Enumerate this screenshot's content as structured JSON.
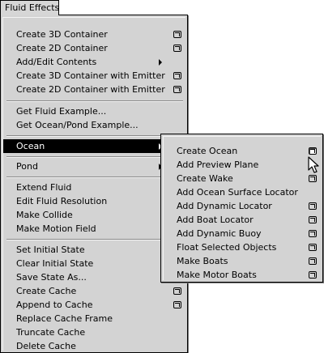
{
  "menubar": {
    "title": "Fluid Effects"
  },
  "menu": {
    "group1": [
      {
        "label": "Create 3D Container",
        "option_box": true
      },
      {
        "label": "Create 2D Container",
        "option_box": true
      },
      {
        "label": "Add/Edit Contents",
        "submenu": true
      },
      {
        "label": "Create 3D Container with Emitter",
        "option_box": true
      },
      {
        "label": "Create 2D Container with Emitter",
        "option_box": true
      }
    ],
    "group2": [
      {
        "label": "Get Fluid Example..."
      },
      {
        "label": "Get Ocean/Pond Example..."
      }
    ],
    "group3": [
      {
        "label": "Ocean",
        "submenu": true,
        "highlighted": true
      }
    ],
    "group4": [
      {
        "label": "Pond",
        "submenu": true
      }
    ],
    "group5": [
      {
        "label": "Extend Fluid"
      },
      {
        "label": "Edit Fluid Resolution"
      },
      {
        "label": "Make Collide"
      },
      {
        "label": "Make Motion Field"
      }
    ],
    "group6": [
      {
        "label": "Set Initial State"
      },
      {
        "label": "Clear Initial State"
      },
      {
        "label": "Save State As..."
      },
      {
        "label": "Create Cache",
        "option_box": true
      },
      {
        "label": "Append to Cache",
        "option_box": true
      },
      {
        "label": "Replace Cache Frame"
      },
      {
        "label": "Truncate Cache"
      },
      {
        "label": "Delete Cache"
      }
    ]
  },
  "ocean_submenu": [
    {
      "label": "Create Ocean",
      "option_box": true,
      "option_pressed": true
    },
    {
      "label": "Add Preview Plane"
    },
    {
      "label": "Create Wake",
      "option_box": true
    },
    {
      "label": "Add Ocean Surface Locator"
    },
    {
      "label": "Add Dynamic Locator",
      "option_box": true
    },
    {
      "label": "Add Boat Locator",
      "option_box": true
    },
    {
      "label": "Add Dynamic Buoy",
      "option_box": true
    },
    {
      "label": "Float Selected Objects",
      "option_box": true
    },
    {
      "label": "Make Boats",
      "option_box": true
    },
    {
      "label": "Make Motor Boats",
      "option_box": true
    }
  ],
  "colors": {
    "menu_bg": "#d3d3d3",
    "highlight_bg": "#000000",
    "highlight_text": "#ffffff"
  }
}
